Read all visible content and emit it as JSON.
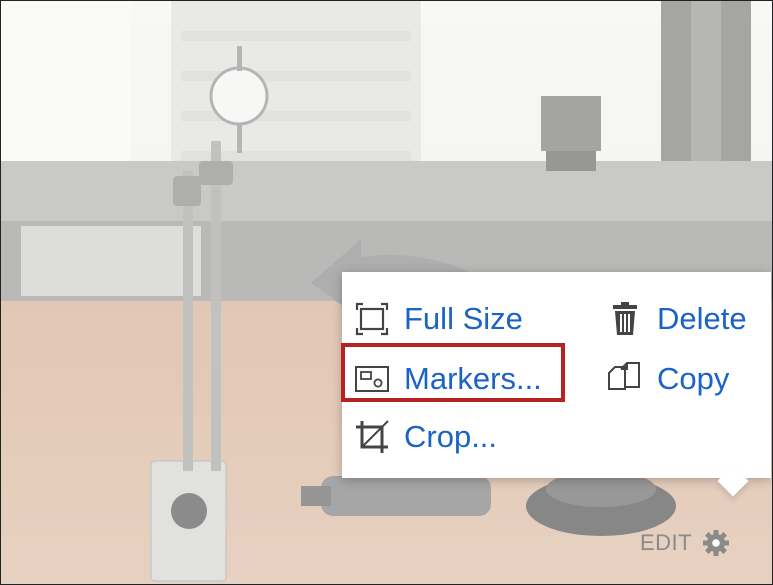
{
  "menu": {
    "full_size": {
      "label": "Full Size",
      "icon": "full-size-icon"
    },
    "delete": {
      "label": "Delete",
      "icon": "trash-icon"
    },
    "markers": {
      "label": "Markers...",
      "icon": "markers-icon"
    },
    "copy": {
      "label": "Copy",
      "icon": "copy-icon"
    },
    "crop": {
      "label": "Crop...",
      "icon": "crop-icon"
    }
  },
  "edit_bar": {
    "label": "EDIT",
    "icon": "gear-icon"
  },
  "colors": {
    "link": "#1b63c4",
    "highlight": "#b72222",
    "icon": "#444444",
    "muted": "#8a8a8a"
  }
}
